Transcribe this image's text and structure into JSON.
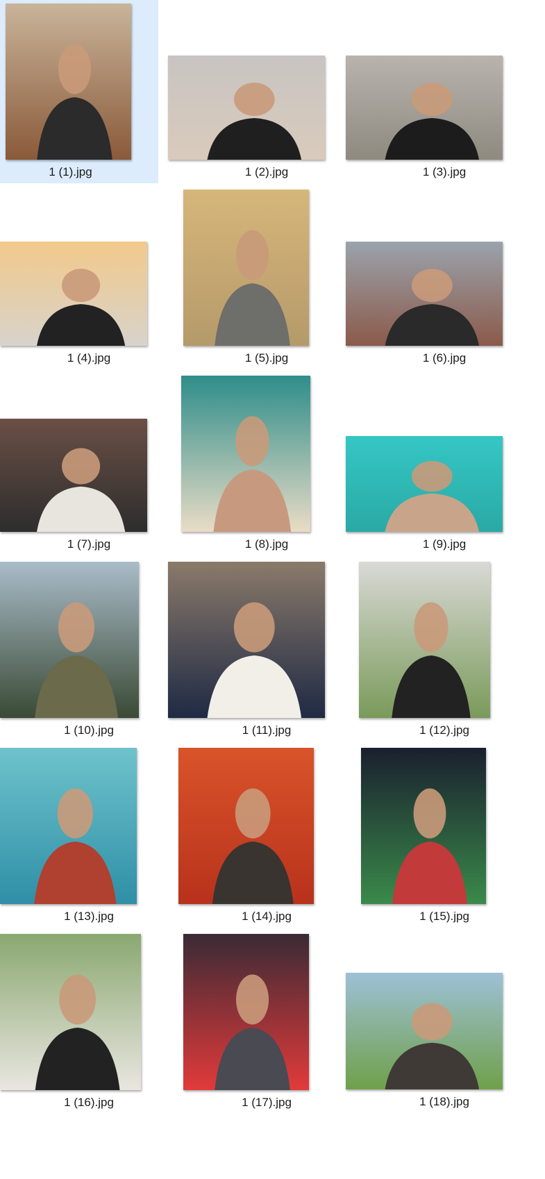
{
  "file_view": {
    "selected_index": 0,
    "items": [
      {
        "filename": "1 (1).jpg",
        "thumb_icon": "photo-thumbnail-icon",
        "colors": [
          "#c9b49a",
          "#8a5a3a",
          "#2b2b2b"
        ]
      },
      {
        "filename": "1 (2).jpg",
        "thumb_icon": "photo-thumbnail-icon",
        "colors": [
          "#c8c4c2",
          "#d9cbbb",
          "#1f1f1f"
        ]
      },
      {
        "filename": "1 (3).jpg",
        "thumb_icon": "photo-thumbnail-icon",
        "colors": [
          "#b8b3ad",
          "#8f8a80",
          "#1c1c1c"
        ]
      },
      {
        "filename": "1 (4).jpg",
        "thumb_icon": "photo-thumbnail-icon",
        "colors": [
          "#f2c98a",
          "#d8d3cc",
          "#222222"
        ]
      },
      {
        "filename": "1 (5).jpg",
        "thumb_icon": "photo-thumbnail-icon",
        "colors": [
          "#d6b67a",
          "#b59a6a",
          "#6e6e6a"
        ]
      },
      {
        "filename": "1 (6).jpg",
        "thumb_icon": "photo-thumbnail-icon",
        "colors": [
          "#9aa3ad",
          "#8b5a4a",
          "#2a2a2a"
        ]
      },
      {
        "filename": "1 (7).jpg",
        "thumb_icon": "photo-thumbnail-icon",
        "colors": [
          "#6a4f45",
          "#2d2d2d",
          "#e8e4de"
        ]
      },
      {
        "filename": "1 (8).jpg",
        "thumb_icon": "photo-thumbnail-icon",
        "colors": [
          "#2e8d8a",
          "#e9dcc6",
          "#c79a80"
        ]
      },
      {
        "filename": "1 (9).jpg",
        "thumb_icon": "photo-thumbnail-icon",
        "colors": [
          "#35c7c4",
          "#2aa9a6",
          "#c8a58a"
        ]
      },
      {
        "filename": "1 (10).jpg",
        "thumb_icon": "photo-thumbnail-icon",
        "colors": [
          "#a9bcc9",
          "#3a4a35",
          "#6b6a4a"
        ]
      },
      {
        "filename": "1 (11).jpg",
        "thumb_icon": "photo-thumbnail-icon",
        "colors": [
          "#8a7a6a",
          "#1f2a44",
          "#f2efe9"
        ]
      },
      {
        "filename": "1 (12).jpg",
        "thumb_icon": "photo-thumbnail-icon",
        "colors": [
          "#d9d9d6",
          "#7a9a5a",
          "#222222"
        ]
      },
      {
        "filename": "1 (13).jpg",
        "thumb_icon": "photo-thumbnail-icon",
        "colors": [
          "#6ec3cc",
          "#2f8fa6",
          "#b04030"
        ]
      },
      {
        "filename": "1 (14).jpg",
        "thumb_icon": "photo-thumbnail-icon",
        "colors": [
          "#d9532a",
          "#b8321c",
          "#3a3430"
        ]
      },
      {
        "filename": "1 (15).jpg",
        "thumb_icon": "photo-thumbnail-icon",
        "colors": [
          "#1a1f2e",
          "#3a8a4a",
          "#c23a3a"
        ]
      },
      {
        "filename": "1 (16).jpg",
        "thumb_icon": "photo-thumbnail-icon",
        "colors": [
          "#8aa870",
          "#e9e6e0",
          "#222222"
        ]
      },
      {
        "filename": "1 (17).jpg",
        "thumb_icon": "photo-thumbnail-icon",
        "colors": [
          "#3a2a35",
          "#e23a3a",
          "#4a4a52"
        ]
      },
      {
        "filename": "1 (18).jpg",
        "thumb_icon": "photo-thumbnail-icon",
        "colors": [
          "#9ec0d6",
          "#6fa04a",
          "#3f3a36"
        ]
      }
    ]
  },
  "theme": {
    "selection_bg": "#dcecfc",
    "label_color": "#1a1a1a"
  }
}
